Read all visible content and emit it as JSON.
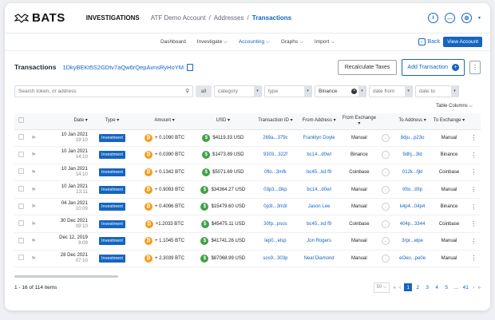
{
  "brand": "BATS",
  "breadcrumb": {
    "app": "INVESTIGATIONS",
    "account": "ATF Demo Account",
    "sep": "/",
    "addresses": "Addresses",
    "current": "Transactions"
  },
  "subnav": {
    "items": [
      "Dashboard",
      "Investigate",
      "Accounting",
      "Graphs",
      "Import"
    ],
    "active": "Accounting",
    "back": "Back",
    "view_account": "View Account"
  },
  "header": {
    "title": "Transactions",
    "address": "1DkyBEKt5S2GDtv7aQw6rQepAvnsRyHoYM",
    "recalc": "Recalculate Taxes",
    "add": "Add Transaction"
  },
  "filters": {
    "search_placeholder": "Search token, or address",
    "all": "all",
    "category": "category",
    "type": "type",
    "exchange": "Binance",
    "date_from": "date from",
    "date_to": "date to"
  },
  "table_columns": "Table Columns",
  "columns": [
    "Date",
    "Type",
    "Amount",
    "USD",
    "Transaction ID",
    "From Address",
    "From Exchange",
    "To Address",
    "To Exchange"
  ],
  "rows": [
    {
      "date": "10 Jan 2021",
      "time": "19:10",
      "type": "Investment",
      "amount": "+ 0.1090 BTC",
      "usd": "$4119.33 USD",
      "txid": "269a...379c",
      "from": "Franklyn Doyle",
      "fromex": "Manual",
      "to": "8dju...p23o",
      "toex": "Manual"
    },
    {
      "date": "10 Jan 2021",
      "time": "14:10",
      "type": "Investment",
      "amount": "+ 0.0390 BTC",
      "usd": "$1473.89 USD",
      "txid": "9303...322f",
      "from": "bc14...d0wl",
      "fromex": "Binance",
      "to": "9dhj...3ld",
      "toex": "Binance"
    },
    {
      "date": "10 Jan 2021",
      "time": "14:10",
      "type": "Investment",
      "amount": "+ 0.1342 BTC",
      "usd": "$5071.69 USD",
      "txid": "0flo...3mfk",
      "from": "bc45...kd f9",
      "fromex": "Coinbase",
      "to": "012k...fjkl",
      "toex": "Coinbase"
    },
    {
      "date": "10 Jan 2021",
      "time": "13:11",
      "type": "Investment",
      "amount": "+ 0.9093 BTC",
      "usd": "$34364.27 USD",
      "txid": "03p3...l3kp",
      "from": "bc14...d0wl",
      "fromex": "Manual",
      "to": "t0to...t0lp",
      "toex": "Manual"
    },
    {
      "date": "04 Jan 2021",
      "time": "10:09",
      "type": "Investment",
      "amount": "+ 0.4096 BTC",
      "usd": "$15479.60 USD",
      "txid": "0p3l...3m3l",
      "from": "Jason Lee",
      "fromex": "Manual",
      "to": "k4p4...04p4",
      "toex": "Binance"
    },
    {
      "date": "30 Dec 2021",
      "time": "09:10",
      "type": "Investment",
      "amount": "+1.2033 BTC",
      "usd": "$45475.11 USD",
      "txid": "30fp...psos",
      "from": "bc45...kd f9",
      "fromex": "Coinbase",
      "to": "404p...3344",
      "toex": "Coinbase"
    },
    {
      "date": "Dec 12,  2019",
      "time": "9:09",
      "type": "Investment",
      "amount": "+ 1.1045 BTC",
      "usd": "$41741.26 USD",
      "txid": "lep0...elsp",
      "from": "Jon Rogers",
      "fromex": "Manual",
      "to": "3rpr...elpe",
      "toex": "Manual"
    },
    {
      "date": "28 Dec 2021",
      "time": "07:10",
      "type": "Investment",
      "amount": "+ 2.3039 BTC",
      "usd": "$87068.99 USD",
      "txid": "sos9...303p",
      "from": "Neal Diamond",
      "fromex": "Manual",
      "to": "eOeo...pe0e",
      "toex": "Manual"
    }
  ],
  "footer": {
    "count": "1 - 16 of 114 items",
    "per_page": "50",
    "pages": [
      "1",
      "2",
      "3",
      "4",
      "5",
      "...",
      "41"
    ],
    "current": "1"
  }
}
